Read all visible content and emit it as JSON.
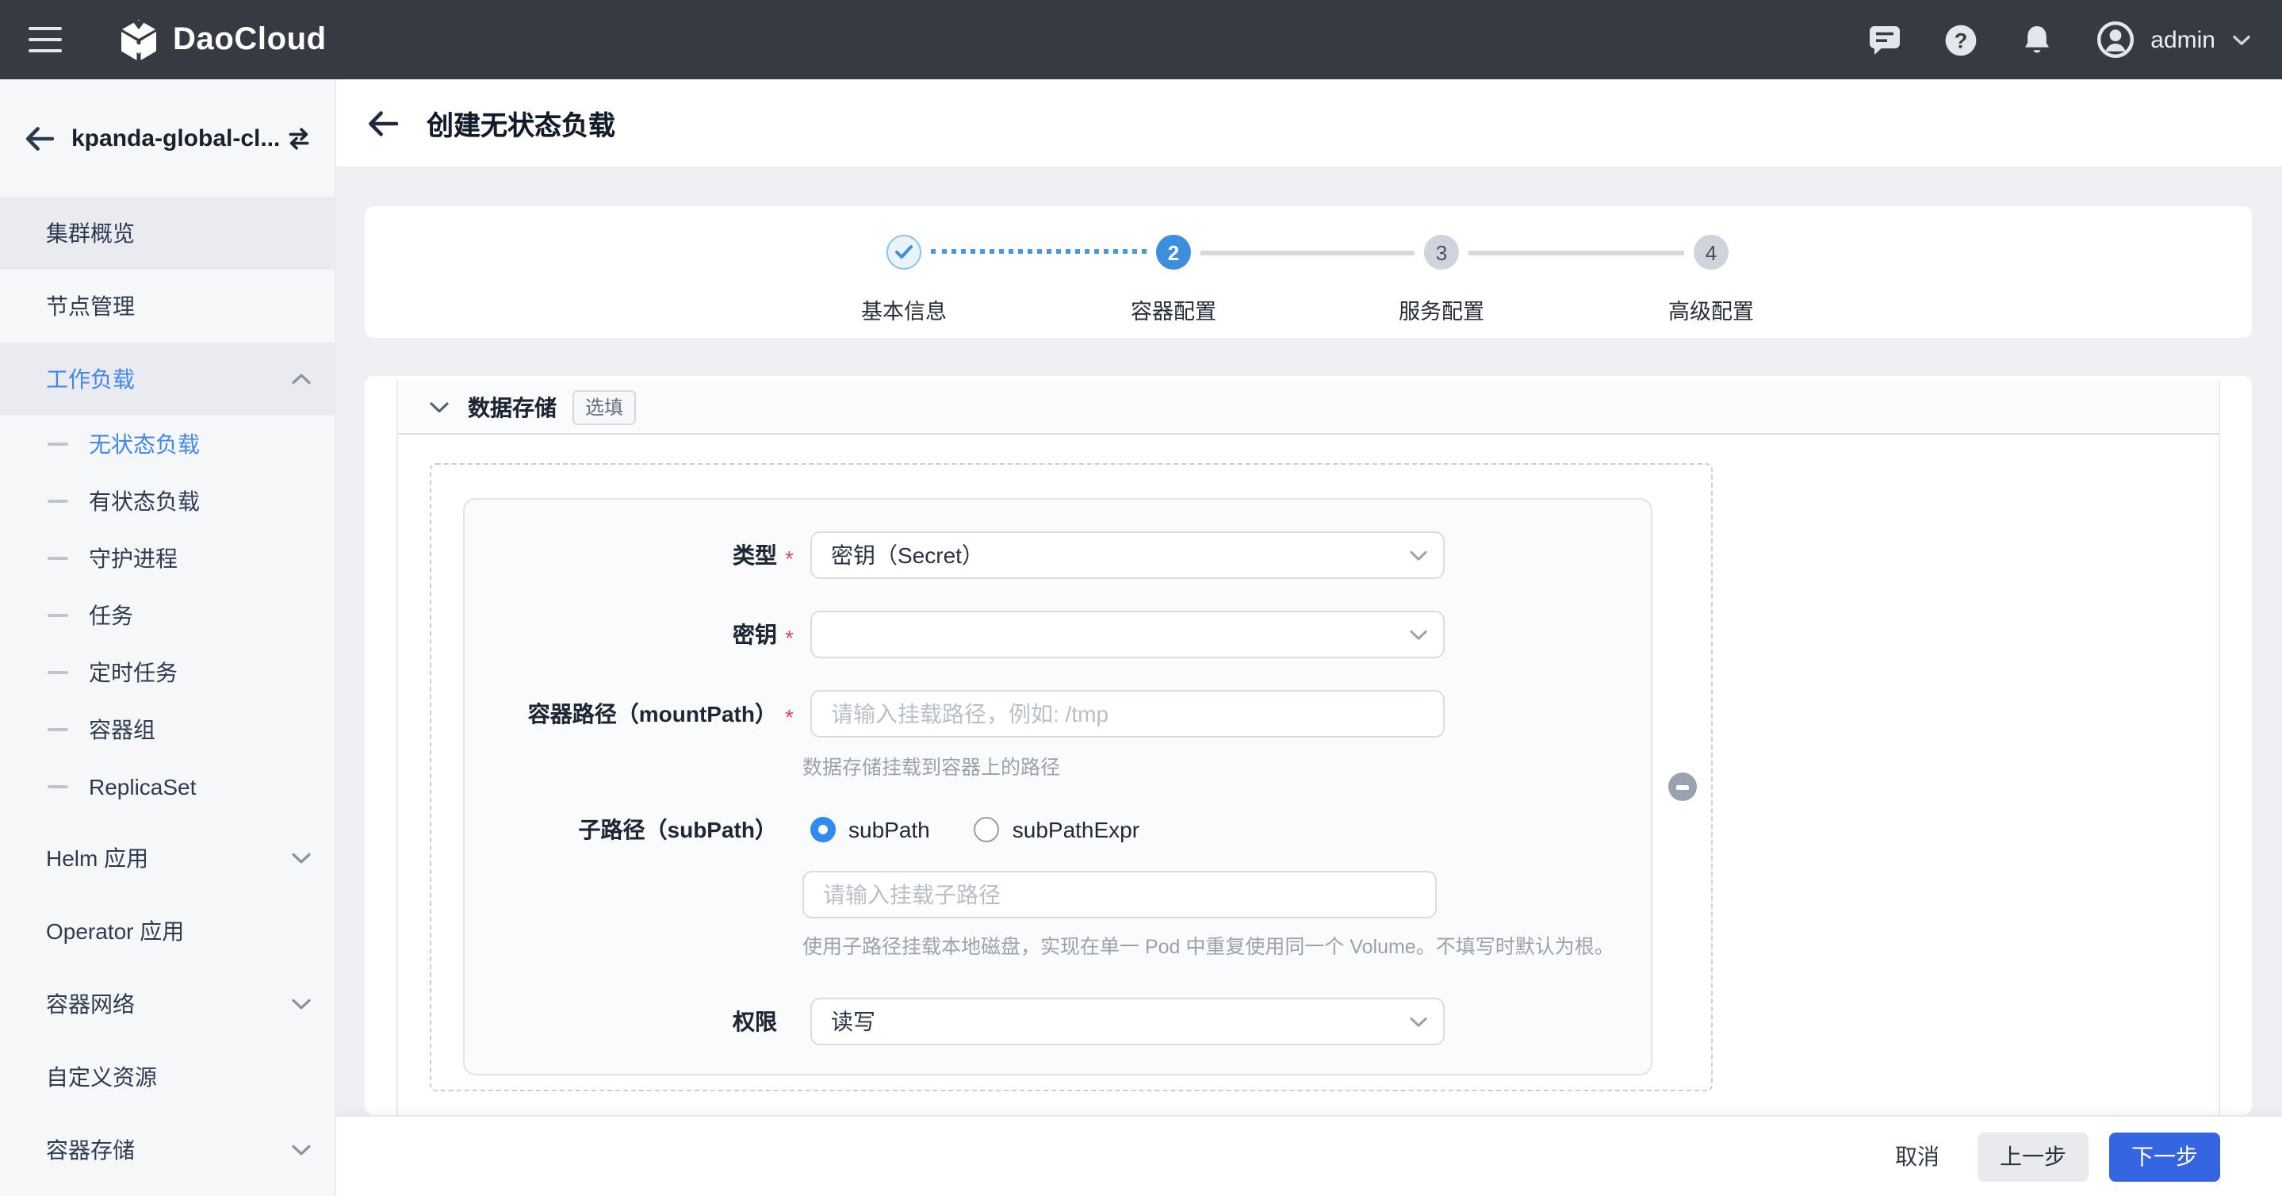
{
  "palette": {
    "topbar_bg": "#363a43",
    "accent_blue": "#3565e0",
    "link_blue": "#4286f5",
    "step_blue": "#3e8ede",
    "radio_blue": "#2f8cee",
    "required_red": "#e5484d",
    "sidebar_bg": "#f6f7f9",
    "main_bg": "#eef0f4"
  },
  "topbar": {
    "brand": "DaoCloud",
    "user": "admin"
  },
  "sidebar": {
    "cluster": "kpanda-global-cl...",
    "items": [
      {
        "label": "集群概览"
      },
      {
        "label": "节点管理"
      },
      {
        "label": "工作负载"
      },
      {
        "label": "Helm 应用"
      },
      {
        "label": "Operator 应用"
      },
      {
        "label": "容器网络"
      },
      {
        "label": "自定义资源"
      },
      {
        "label": "容器存储"
      }
    ],
    "workload_children": [
      {
        "label": "无状态负载"
      },
      {
        "label": "有状态负载"
      },
      {
        "label": "守护进程"
      },
      {
        "label": "任务"
      },
      {
        "label": "定时任务"
      },
      {
        "label": "容器组"
      },
      {
        "label": "ReplicaSet"
      }
    ]
  },
  "page": {
    "title": "创建无状态负载"
  },
  "stepper": {
    "steps": [
      {
        "label": "基本信息",
        "state": "done",
        "number": ""
      },
      {
        "label": "容器配置",
        "state": "active",
        "number": "2"
      },
      {
        "label": "服务配置",
        "state": "todo",
        "number": "3"
      },
      {
        "label": "高级配置",
        "state": "todo",
        "number": "4"
      }
    ]
  },
  "section": {
    "title": "数据存储",
    "badge": "选填"
  },
  "form": {
    "type": {
      "label": "类型",
      "required": "*",
      "value": "密钥（Secret）"
    },
    "secret": {
      "label": "密钥",
      "required": "*",
      "value": ""
    },
    "mount_path": {
      "label": "容器路径（mountPath）",
      "required": "*",
      "placeholder": "请输入挂载路径，例如: /tmp",
      "helper": "数据存储挂载到容器上的路径"
    },
    "sub_path": {
      "label": "子路径（subPath）",
      "options": [
        {
          "label": "subPath",
          "selected": true
        },
        {
          "label": "subPathExpr",
          "selected": false
        }
      ],
      "placeholder": "请输入挂载子路径",
      "helper": "使用子路径挂载本地磁盘，实现在单一 Pod 中重复使用同一个 Volume。不填写时默认为根。"
    },
    "permission": {
      "label": "权限",
      "value": "读写"
    }
  },
  "footer": {
    "cancel": "取消",
    "prev": "上一步",
    "next": "下一步"
  }
}
